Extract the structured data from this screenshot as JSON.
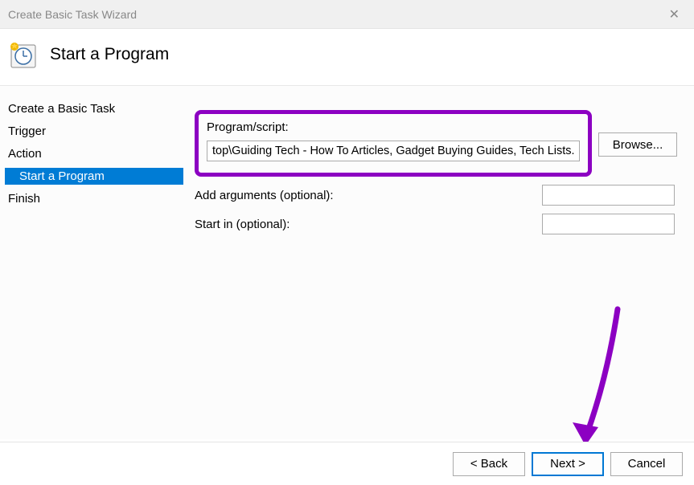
{
  "titlebar": {
    "title": "Create Basic Task Wizard"
  },
  "header": {
    "title": "Start a Program"
  },
  "sidebar": {
    "steps": [
      {
        "label": "Create a Basic Task",
        "active": false,
        "sub": false
      },
      {
        "label": "Trigger",
        "active": false,
        "sub": false
      },
      {
        "label": "Action",
        "active": false,
        "sub": false
      },
      {
        "label": "Start a Program",
        "active": true,
        "sub": true
      },
      {
        "label": "Finish",
        "active": false,
        "sub": false
      }
    ]
  },
  "main": {
    "programLabel": "Program/script:",
    "programValue": "top\\Guiding Tech - How To Articles, Gadget Buying Guides, Tech Lists.url\"",
    "browseLabel": "Browse...",
    "argsLabel": "Add arguments (optional):",
    "argsValue": "",
    "startInLabel": "Start in (optional):",
    "startInValue": ""
  },
  "footer": {
    "back": "< Back",
    "next": "Next >",
    "cancel": "Cancel"
  },
  "annotation": {
    "highlightColor": "#8c00c2",
    "arrowColor": "#8c00c2"
  }
}
